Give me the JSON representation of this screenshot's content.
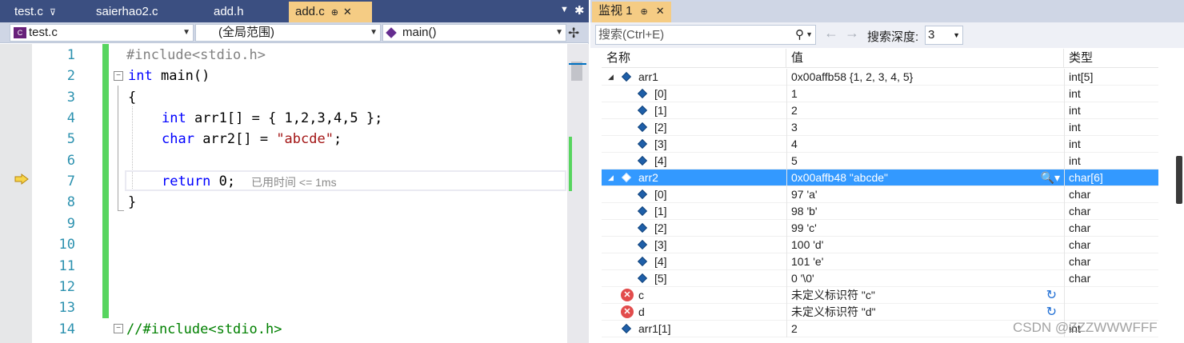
{
  "editor": {
    "tabs": [
      {
        "label": "test.c",
        "pin": "⊽"
      },
      {
        "label": "saierhao2.c"
      },
      {
        "label": "add.h"
      },
      {
        "label": "add.c",
        "pin": "⊕",
        "close": "✕"
      }
    ],
    "nav": {
      "file": "test.c",
      "scope": "(全局范围)",
      "function": "main()"
    },
    "line_numbers": [
      "1",
      "2",
      "3",
      "4",
      "5",
      "6",
      "7",
      "8",
      "9",
      "10",
      "11",
      "12",
      "13",
      "14"
    ],
    "code": {
      "l1": "#include<stdio.h>",
      "l2_kw": "int",
      "l2_rest": " main()",
      "l3": "{",
      "l4_kw": "int",
      "l4_rest": " arr1[] = { 1,2,3,4,5 };",
      "l5_kw": "char",
      "l5_rest": " arr2[] = ",
      "l5_str": "\"abcde\"",
      "l5_end": ";",
      "l7_kw": "return",
      "l7_rest": " 0;",
      "l8": "}",
      "l14": "//#include<stdio.h>"
    },
    "elapsed_hint": "已用时间 <= 1ms"
  },
  "watch": {
    "title": "监视 1",
    "search_placeholder": "搜索(Ctrl+E)",
    "depth_label": "搜索深度:",
    "depth_value": "3",
    "columns": {
      "name": "名称",
      "value": "值",
      "type": "类型"
    },
    "rows": [
      {
        "name": "arr1",
        "value": "0x00affb58 {1, 2, 3, 4, 5}",
        "type": "int[5]",
        "level": 0,
        "icon": "object",
        "expanded": true
      },
      {
        "name": "[0]",
        "value": "1",
        "type": "int",
        "level": 1,
        "icon": "object"
      },
      {
        "name": "[1]",
        "value": "2",
        "type": "int",
        "level": 1,
        "icon": "object"
      },
      {
        "name": "[2]",
        "value": "3",
        "type": "int",
        "level": 1,
        "icon": "object"
      },
      {
        "name": "[3]",
        "value": "4",
        "type": "int",
        "level": 1,
        "icon": "object"
      },
      {
        "name": "[4]",
        "value": "5",
        "type": "int",
        "level": 1,
        "icon": "object"
      },
      {
        "name": "arr2",
        "value": "0x00affb48 \"abcde\"",
        "type": "char[6]",
        "level": 0,
        "icon": "object",
        "expanded": true,
        "selected": true
      },
      {
        "name": "[0]",
        "value": "97 'a'",
        "type": "char",
        "level": 1,
        "icon": "object"
      },
      {
        "name": "[1]",
        "value": "98 'b'",
        "type": "char",
        "level": 1,
        "icon": "object"
      },
      {
        "name": "[2]",
        "value": "99 'c'",
        "type": "char",
        "level": 1,
        "icon": "object"
      },
      {
        "name": "[3]",
        "value": "100 'd'",
        "type": "char",
        "level": 1,
        "icon": "object"
      },
      {
        "name": "[4]",
        "value": "101 'e'",
        "type": "char",
        "level": 1,
        "icon": "object"
      },
      {
        "name": "[5]",
        "value": "0 '\\0'",
        "type": "char",
        "level": 1,
        "icon": "object"
      },
      {
        "name": "c",
        "value": "未定义标识符 \"c\"",
        "type": "",
        "level": 0,
        "icon": "error",
        "refresh": true
      },
      {
        "name": "d",
        "value": "未定义标识符 \"d\"",
        "type": "",
        "level": 0,
        "icon": "error",
        "refresh": true
      },
      {
        "name": "arr1[1]",
        "value": "2",
        "type": "int",
        "level": 0,
        "icon": "object"
      }
    ]
  },
  "watermark": "CSDN @ZZZWWWFFF"
}
